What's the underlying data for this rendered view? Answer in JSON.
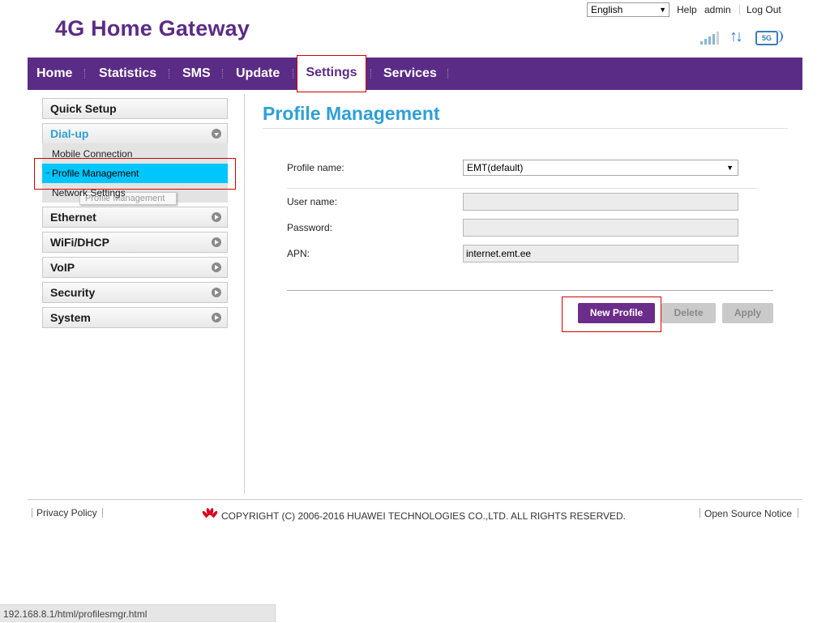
{
  "header": {
    "logo": "4G Home Gateway",
    "language": "English",
    "help": "Help",
    "user": "admin",
    "logout": "Log Out",
    "network_type": "5G"
  },
  "nav": {
    "items": [
      {
        "label": "Home"
      },
      {
        "label": "Statistics"
      },
      {
        "label": "SMS"
      },
      {
        "label": "Update"
      },
      {
        "label": "Settings",
        "active": true
      },
      {
        "label": "Services"
      }
    ]
  },
  "sidebar": {
    "quick_setup": "Quick Setup",
    "dialup": "Dial-up",
    "dialup_items": [
      "Mobile Connection",
      "Profile Management",
      "Network Settings"
    ],
    "tooltip": "Profile Management",
    "ethernet": "Ethernet",
    "wifi_dhcp": "WiFi/DHCP",
    "voip": "VoIP",
    "security": "Security",
    "system": "System"
  },
  "main": {
    "title": "Profile Management",
    "profile_name_label": "Profile name:",
    "profile_name_value": "EMT(default)",
    "username_label": "User name:",
    "username_value": "",
    "password_label": "Password:",
    "password_value": "",
    "apn_label": "APN:",
    "apn_value": "internet.emt.ee",
    "buttons": {
      "new_profile": "New Profile",
      "delete": "Delete",
      "apply": "Apply"
    }
  },
  "footer": {
    "privacy": "Privacy Policy",
    "copyright": "COPYRIGHT (C) 2006-2016 HUAWEI TECHNOLOGIES CO.,LTD. ALL RIGHTS RESERVED.",
    "open_source": "Open Source Notice"
  },
  "statusbar": {
    "url": "192.168.8.1/html/profilesmgr.html"
  },
  "colors": {
    "brand_purple": "#5b2c86",
    "title_blue": "#2ea0d6",
    "active_sub": "#00c6ff",
    "highlight_red": "#d40000"
  }
}
